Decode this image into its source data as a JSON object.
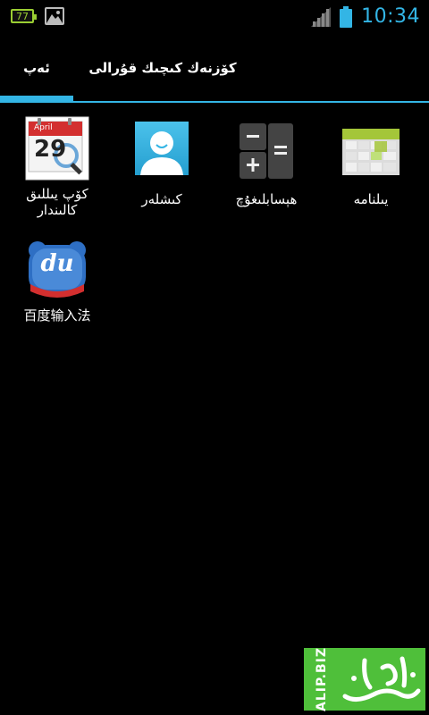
{
  "statusbar": {
    "battery_notification_value": "77",
    "clock": "10:34",
    "icons": [
      "battery-notification-icon",
      "gallery-icon",
      "signal-icon",
      "battery-icon"
    ]
  },
  "tabs": [
    {
      "label": "ئەپ",
      "active": true
    },
    {
      "label": "كۆزنەك كىچىك قۇرالى",
      "active": false
    }
  ],
  "apps": [
    {
      "label": "يىلنامە",
      "icon": "calendar-icon"
    },
    {
      "label": "ھېسابلىغۇچ",
      "icon": "calculator-icon"
    },
    {
      "label": "كىشلەر",
      "icon": "contacts-icon"
    },
    {
      "label": "كۆپ يىللىق كالىندار",
      "icon": "calendar-search-icon",
      "icon_text_month": "April",
      "icon_text_day": "29"
    },
    {
      "label": "百度输入法",
      "icon": "baidu-input-icon",
      "icon_text": "du"
    }
  ],
  "watermark": {
    "text": "ALIP.BIZ",
    "calligraphy": "ئالىپ تور",
    "color": "#4fbf3a"
  },
  "colors": {
    "accent": "#33b5e5",
    "background": "#000000"
  }
}
